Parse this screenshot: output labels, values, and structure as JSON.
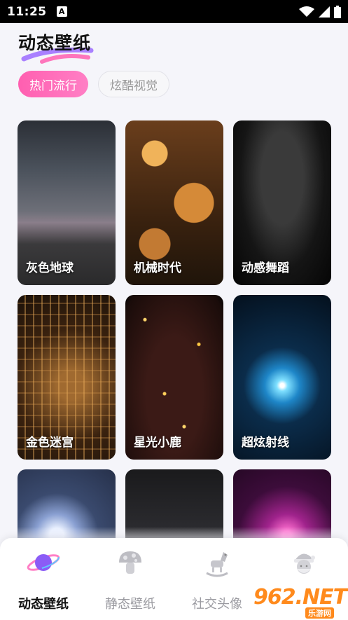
{
  "status_bar": {
    "time": "11:25",
    "notification_icon": "A"
  },
  "header": {
    "title": "动态壁纸"
  },
  "tabs": [
    {
      "label": "热门流行",
      "active": true
    },
    {
      "label": "炫酷视觉",
      "active": false
    }
  ],
  "wallpapers": [
    {
      "label": "灰色地球"
    },
    {
      "label": "机械时代"
    },
    {
      "label": "动感舞蹈"
    },
    {
      "label": "金色迷宫"
    },
    {
      "label": "星光小鹿"
    },
    {
      "label": "超炫射线"
    },
    {
      "label": ""
    },
    {
      "label": ""
    },
    {
      "label": ""
    }
  ],
  "bottom_nav": [
    {
      "label": "动态壁纸",
      "icon": "planet-icon",
      "active": true
    },
    {
      "label": "静态壁纸",
      "icon": "mushroom-icon",
      "active": false
    },
    {
      "label": "社交头像",
      "icon": "rocking-horse-icon",
      "active": false
    },
    {
      "label": "",
      "icon": "santa-icon",
      "active": false
    }
  ],
  "watermark": {
    "main": "962.NET",
    "sub": "乐游网"
  },
  "colors": {
    "accent_pink": "#ff5fb0",
    "watermark_orange": "#ff8a1c"
  }
}
